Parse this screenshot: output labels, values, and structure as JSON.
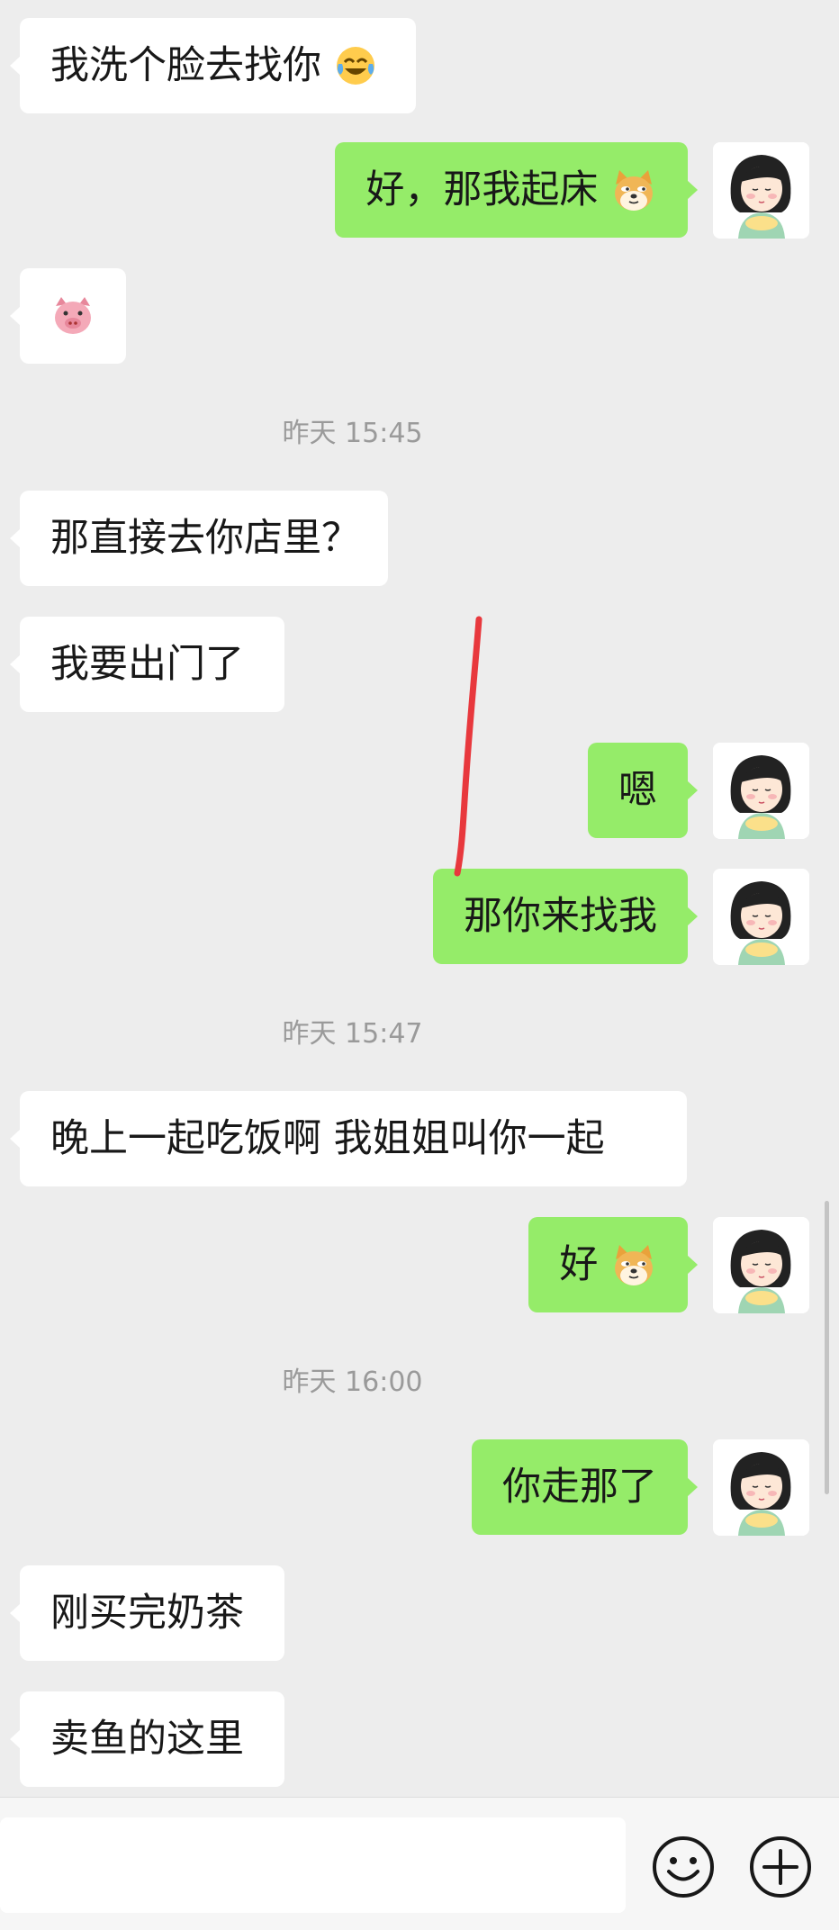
{
  "messages": [
    {
      "side": "in",
      "text": "我洗个脸去找你",
      "emoji": "tears-of-joy-emoji"
    },
    {
      "side": "out",
      "text": "好，那我起床",
      "emoji": "doge-emoji"
    },
    {
      "side": "in",
      "text": "",
      "emoji": "pig-emoji"
    },
    {
      "side": "time",
      "text": "昨天 15:45"
    },
    {
      "side": "in",
      "text": "那直接去你店里？"
    },
    {
      "side": "in",
      "text": "我要出门了"
    },
    {
      "side": "out",
      "text": "嗯"
    },
    {
      "side": "out",
      "text": "那你来找我"
    },
    {
      "side": "time",
      "text": "昨天 15:47"
    },
    {
      "side": "in",
      "text": "晚上一起吃饭啊 我姐姐叫你一起"
    },
    {
      "side": "out",
      "text": "好",
      "emoji": "doge-emoji"
    },
    {
      "side": "time",
      "text": "昨天 16:00"
    },
    {
      "side": "out",
      "text": "你走那了"
    },
    {
      "side": "in",
      "text": "刚买完奶茶"
    },
    {
      "side": "in",
      "text": "卖鱼的这里"
    }
  ],
  "input": {
    "value": "",
    "placeholder": ""
  },
  "icons": {
    "emoji_button": "smiley-face-icon",
    "more_button": "plus-circle-icon"
  },
  "colors": {
    "outgoing_bubble": "#95ec69",
    "incoming_bubble": "#ffffff",
    "background": "#ededed",
    "annotation_stroke": "#e8383d"
  }
}
